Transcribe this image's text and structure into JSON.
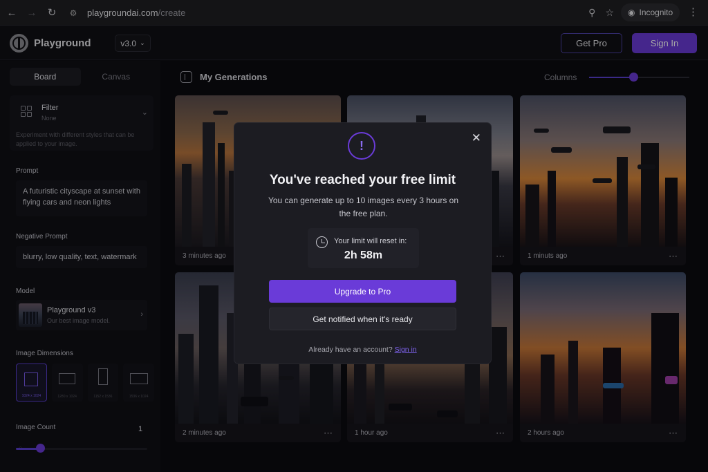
{
  "browser": {
    "url_domain": "playgroundai.com",
    "url_path": "/create",
    "profile_label": "Incognito",
    "icons": [
      "back-icon",
      "forward-icon",
      "reload-icon",
      "site-info-icon",
      "zoom-icon",
      "bookmark-star-icon",
      "incognito-icon",
      "browser-menu-icon"
    ]
  },
  "header": {
    "brand": "Playground",
    "version": "v3.0",
    "get_pro": "Get Pro",
    "sign_in": "Sign In"
  },
  "sidebar": {
    "tabs": [
      "Board",
      "Canvas"
    ],
    "active_tab": "Board",
    "filter": {
      "title": "Filter",
      "value": "None",
      "description": "Experiment with different styles that can be applied to your image."
    },
    "prompt_label": "Prompt",
    "prompt_value": "A futuristic cityscape at sunset with flying cars and neon lights",
    "negative_label": "Negative Prompt",
    "negative_value": "blurry, low quality, text, watermark",
    "model_label": "Model",
    "model_name": "Playground v3",
    "model_desc": "Our best image model.",
    "dimensions_label": "Image Dimensions",
    "dimensions": [
      {
        "label": "1024 x 1024",
        "selected": true
      },
      {
        "label": "1280 x 1024",
        "selected": false
      },
      {
        "label": "1152 x 1536",
        "selected": false
      },
      {
        "label": "1536 x 1024",
        "selected": false
      }
    ],
    "count_label": "Image Count",
    "count_value": "1"
  },
  "main": {
    "title": "My Generations",
    "columns_label": "Columns",
    "columns_level_pct": 44,
    "cards": [
      {
        "time": "3 minutes ago"
      },
      {
        "time": ""
      },
      {
        "time": "1 minuts ago"
      },
      {
        "time": "2 minutes ago"
      },
      {
        "time": "1 hour ago"
      },
      {
        "time": "2 hours ago"
      }
    ]
  },
  "modal": {
    "title": "You've reached your free limit",
    "subtitle": "You can generate up to 10 images every 3 hours on the free plan.",
    "reset_label": "Your limit will reset in:",
    "reset_time": "2h 58m",
    "upgrade_button": "Upgrade to Pro",
    "notify_button": "Get notified when it's ready",
    "account_text": "Already have an account?",
    "account_link": "Sign in"
  },
  "colors": {
    "accent": "#6a3bd8",
    "background": "#0e0e13",
    "modal_bg": "#1c1c22"
  }
}
